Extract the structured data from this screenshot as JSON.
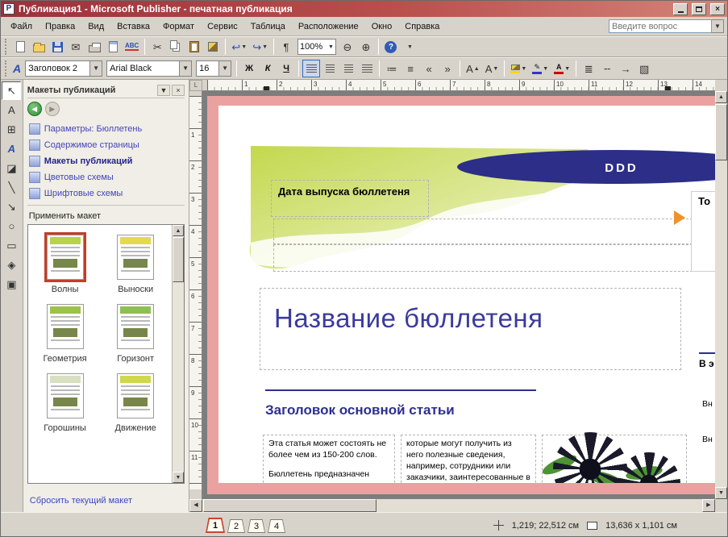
{
  "window": {
    "title": "Публикация1 - Microsoft Publisher - печатная публикация"
  },
  "menubar": {
    "items": [
      {
        "id": "file",
        "label": "Файл"
      },
      {
        "id": "edit",
        "label": "Правка"
      },
      {
        "id": "view",
        "label": "Вид"
      },
      {
        "id": "insert",
        "label": "Вставка"
      },
      {
        "id": "format",
        "label": "Формат"
      },
      {
        "id": "tools",
        "label": "Сервис"
      },
      {
        "id": "table",
        "label": "Таблица"
      },
      {
        "id": "arrange",
        "label": "Расположение"
      },
      {
        "id": "window",
        "label": "Окно"
      },
      {
        "id": "help",
        "label": "Справка"
      }
    ],
    "ask_placeholder": "Введите вопрос"
  },
  "standard_toolbar": {
    "zoom": "100%",
    "spell_label": "ABC"
  },
  "icons": {
    "mail": "✉",
    "cut": "✂",
    "undo": "↩",
    "redo": "↪",
    "paragraph": "¶",
    "zoom_out": "⊖",
    "zoom_in": "⊕",
    "help": "?",
    "indent_decrease": "«",
    "indent_increase": "»",
    "numbered_list": "≔",
    "bullet_list": "≡",
    "line_style": "≣",
    "dash_style": "╌",
    "arrow_style": "→",
    "shadow_style": "▧"
  },
  "formatting_toolbar": {
    "style": "Заголовок 2",
    "font": "Arial Black",
    "size": "16",
    "bold_label": "Ж",
    "italic_label": "К",
    "underline_label": "Ч",
    "font_letter": "А"
  },
  "objects_toolbar": {
    "tools": [
      {
        "id": "select",
        "glyph": "↖",
        "pressed": true
      },
      {
        "id": "text-box",
        "glyph": "A"
      },
      {
        "id": "insert-table",
        "glyph": "⊞"
      },
      {
        "id": "insert-wordart",
        "glyph": "А",
        "cls": "wordart"
      },
      {
        "id": "picture-frame",
        "glyph": "◪"
      },
      {
        "id": "line",
        "glyph": "╲"
      },
      {
        "id": "arrow",
        "glyph": "↘"
      },
      {
        "id": "oval",
        "glyph": "○"
      },
      {
        "id": "rectangle",
        "glyph": "▭"
      },
      {
        "id": "hotspot",
        "glyph": "◈"
      },
      {
        "id": "design-gallery-object",
        "glyph": "▣"
      }
    ]
  },
  "taskpane": {
    "title": "Макеты публикаций",
    "links": [
      {
        "id": "options",
        "label": "Параметры: Бюллетень"
      },
      {
        "id": "page-content",
        "label": "Содержимое страницы"
      },
      {
        "id": "publication-designs",
        "label": "Макеты публикаций",
        "active": true
      },
      {
        "id": "color-schemes",
        "label": "Цветовые схемы"
      },
      {
        "id": "font-schemes",
        "label": "Шрифтовые схемы"
      }
    ],
    "apply_label": "Применить макет",
    "layouts": [
      {
        "id": "volny",
        "label": "Волны",
        "selected": true,
        "accent": "#b9d24b"
      },
      {
        "id": "vynoski",
        "label": "Выноски",
        "accent": "#e5d94e"
      },
      {
        "id": "geometriya",
        "label": "Геометрия",
        "accent": "#9cc24a"
      },
      {
        "id": "gorizont",
        "label": "Горизонт",
        "accent": "#8fbf52"
      },
      {
        "id": "goroshiny",
        "label": "Горошины",
        "accent": "#d8e0c0"
      },
      {
        "id": "dvizhenie",
        "label": "Движение",
        "accent": "#cfd84e"
      }
    ],
    "reset_link": "Сбросить текущий макет"
  },
  "rulers": {
    "horizontal": {
      "numbers": [
        "1",
        "2",
        "3",
        "4",
        "5",
        "6",
        "7",
        "8",
        "9",
        "10",
        "11",
        "12",
        "13",
        "14"
      ],
      "start": 46,
      "step": 43
    },
    "vertical": {
      "numbers": [
        "1",
        "2",
        "3",
        "4",
        "5",
        "6",
        "7",
        "8",
        "9",
        "10",
        "11"
      ],
      "start": 44,
      "step": 40
    }
  },
  "canvas": {
    "masthead_badge": "DDD",
    "date_label": "Дата выпуска бюллетеня",
    "newsletter_title": "Название бюллетеня",
    "article_headline": "Заголовок основной статьи",
    "article_col1_p1": "Эта статья может состоять не более чем из 150-200 слов.",
    "article_col1_p2": "Бюллетень предназначен",
    "article_col2": "которые могут получить из него полезные сведения, например, сотрудники или заказчики, заинтересованные в",
    "sidebar_top_partial": "То",
    "sidebar_issue_partial": "В э",
    "sidebar_item1_partial": "Вн",
    "sidebar_item2_partial": "Вн"
  },
  "pagenav": {
    "pages": [
      "1",
      "2",
      "3",
      "4"
    ],
    "current": "1"
  },
  "statusbar": {
    "position": "1,219; 22,512 см",
    "object_size": "13,636 x 1,101 см"
  }
}
